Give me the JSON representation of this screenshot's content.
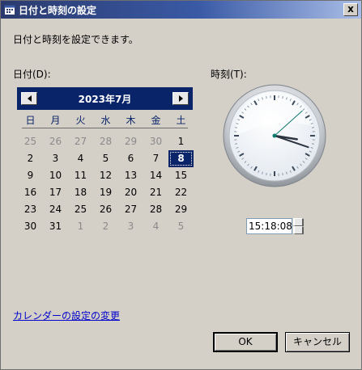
{
  "window": {
    "title": "日付と時刻の設定",
    "close_label": "x"
  },
  "description": "日付と時刻を設定できます。",
  "date_label": "日付(D):",
  "time_label": "時刻(T):",
  "calendar": {
    "month_label": "2023年7月",
    "weekdays": [
      "日",
      "月",
      "火",
      "水",
      "木",
      "金",
      "土"
    ],
    "selected_day": "8",
    "weeks": [
      [
        {
          "d": "25",
          "o": true
        },
        {
          "d": "26",
          "o": true
        },
        {
          "d": "27",
          "o": true
        },
        {
          "d": "28",
          "o": true
        },
        {
          "d": "29",
          "o": true
        },
        {
          "d": "30",
          "o": true
        },
        {
          "d": "1",
          "o": false
        }
      ],
      [
        {
          "d": "2",
          "o": false
        },
        {
          "d": "3",
          "o": false
        },
        {
          "d": "4",
          "o": false
        },
        {
          "d": "5",
          "o": false
        },
        {
          "d": "6",
          "o": false
        },
        {
          "d": "7",
          "o": false
        },
        {
          "d": "8",
          "o": false
        }
      ],
      [
        {
          "d": "9",
          "o": false
        },
        {
          "d": "10",
          "o": false
        },
        {
          "d": "11",
          "o": false
        },
        {
          "d": "12",
          "o": false
        },
        {
          "d": "13",
          "o": false
        },
        {
          "d": "14",
          "o": false
        },
        {
          "d": "15",
          "o": false
        }
      ],
      [
        {
          "d": "16",
          "o": false
        },
        {
          "d": "17",
          "o": false
        },
        {
          "d": "18",
          "o": false
        },
        {
          "d": "19",
          "o": false
        },
        {
          "d": "20",
          "o": false
        },
        {
          "d": "21",
          "o": false
        },
        {
          "d": "22",
          "o": false
        }
      ],
      [
        {
          "d": "23",
          "o": false
        },
        {
          "d": "24",
          "o": false
        },
        {
          "d": "25",
          "o": false
        },
        {
          "d": "26",
          "o": false
        },
        {
          "d": "27",
          "o": false
        },
        {
          "d": "28",
          "o": false
        },
        {
          "d": "29",
          "o": false
        }
      ],
      [
        {
          "d": "30",
          "o": false
        },
        {
          "d": "31",
          "o": false
        },
        {
          "d": "1",
          "o": true
        },
        {
          "d": "2",
          "o": true
        },
        {
          "d": "3",
          "o": true
        },
        {
          "d": "4",
          "o": true
        },
        {
          "d": "5",
          "o": true
        }
      ]
    ]
  },
  "clock": {
    "time_value": "15:18:08",
    "hour": 15,
    "minute": 18,
    "second": 8
  },
  "change_calendar_link": "カレンダーの設定の変更",
  "buttons": {
    "ok": "OK",
    "cancel": "キャンセル"
  },
  "colors": {
    "calendar_header": "#0a246a",
    "link": "#0000cc",
    "window_bg": "#d4d0c8"
  }
}
